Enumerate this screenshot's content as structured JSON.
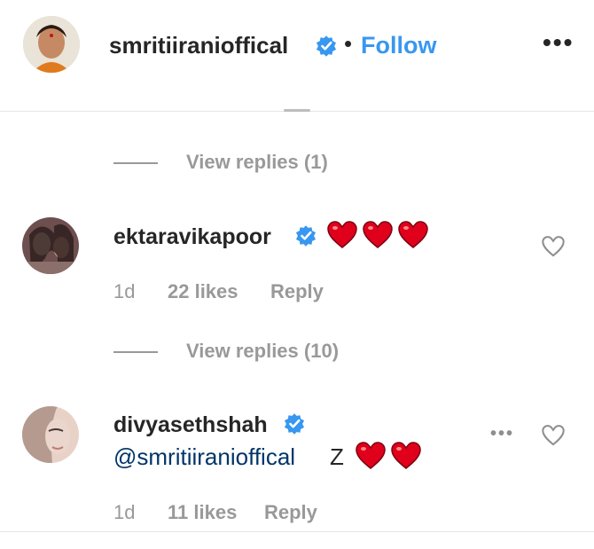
{
  "header": {
    "username": "smritiiranioffical",
    "separator": "•",
    "follow_label": "Follow",
    "more_icon": "more-options-icon"
  },
  "thread1": {
    "view_replies": "View replies (1)"
  },
  "comment1": {
    "username": "ektaravikapoor",
    "hearts": 3,
    "age": "1d",
    "likes": "22 likes",
    "reply_label": "Reply",
    "view_replies": "View replies (10)"
  },
  "comment2": {
    "username": "divyasethshah",
    "mention": "@smritiiranioffical",
    "text": "Z",
    "hearts": 2,
    "age": "1d",
    "likes": "11 likes",
    "reply_label": "Reply"
  },
  "colors": {
    "accent": "#3897f0",
    "mention": "#003569",
    "muted": "#999999",
    "heart": "#e0001b"
  }
}
